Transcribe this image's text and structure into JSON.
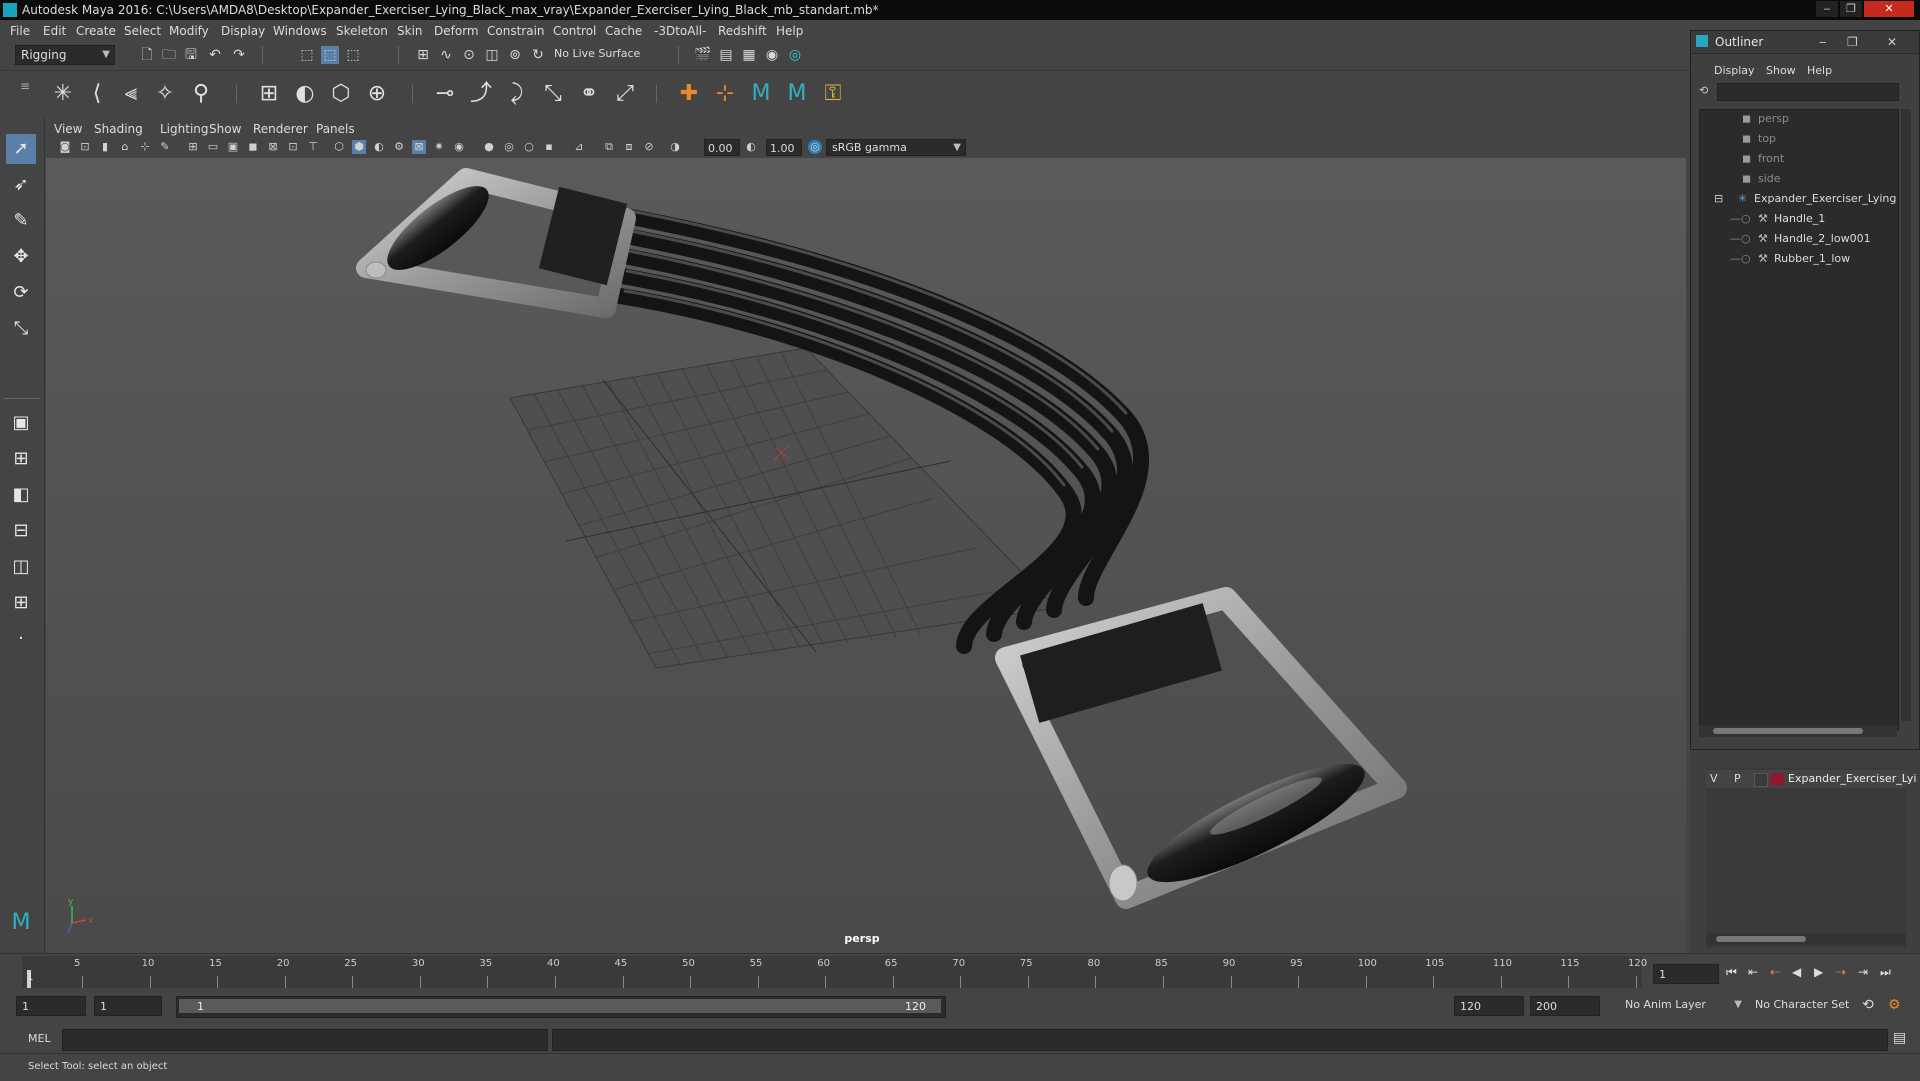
{
  "window": {
    "title": "Autodesk Maya 2016: C:\\Users\\AMDA8\\Desktop\\Expander_Exerciser_Lying_Black_max_vray\\Expander_Exerciser_Lying_Black_mb_standart.mb*",
    "controls": [
      "‒",
      "❐",
      "✕"
    ]
  },
  "menubar": [
    "File",
    "Edit",
    "Create",
    "Select",
    "Modify",
    "Display",
    "Windows",
    "Skeleton",
    "Skin",
    "Deform",
    "Constrain",
    "Control",
    "Cache",
    "-3DtoAll-",
    "Redshift",
    "Help"
  ],
  "shelf": {
    "menu_set": "Rigging",
    "live_surface": "No Live Surface"
  },
  "panel_menu": [
    "View",
    "Shading",
    "Lighting",
    "Show",
    "Renderer",
    "Panels"
  ],
  "viewport_toolbar": {
    "exposure": "0.00",
    "gamma": "1.00",
    "color_space": "sRGB gamma"
  },
  "viewport": {
    "camera_label": "persp",
    "axis_x": "x",
    "axis_y": "y"
  },
  "outliner": {
    "title": "Outliner",
    "menu": [
      "Display",
      "Show",
      "Help"
    ],
    "items": [
      {
        "label": "persp",
        "kind": "camera"
      },
      {
        "label": "top",
        "kind": "camera"
      },
      {
        "label": "front",
        "kind": "camera"
      },
      {
        "label": "side",
        "kind": "camera"
      },
      {
        "label": "Expander_Exerciser_Lying",
        "kind": "group"
      },
      {
        "label": "Handle_1",
        "kind": "mesh"
      },
      {
        "label": "Handle_2_low001",
        "kind": "mesh"
      },
      {
        "label": "Rubber_1_low",
        "kind": "mesh"
      }
    ]
  },
  "layer_editor": {
    "visible": "V",
    "playback": "P",
    "layer_name": "Expander_Exerciser_Lyi",
    "layer_color": "#8b1a2c"
  },
  "timeline": {
    "ticks": [
      "5",
      "10",
      "15",
      "20",
      "25",
      "30",
      "35",
      "40",
      "45",
      "50",
      "55",
      "60",
      "65",
      "70",
      "75",
      "80",
      "85",
      "90",
      "95",
      "100",
      "105",
      "110",
      "115",
      "120"
    ],
    "current_frame_marker": "1",
    "current_frame": "1"
  },
  "range": {
    "start": "1",
    "playback_start": "1",
    "slider_start": "1",
    "slider_end": "120",
    "playback_end": "120",
    "end": "200",
    "anim_layer": "No Anim Layer",
    "character_set": "No Character Set"
  },
  "command_line": {
    "label": "MEL"
  },
  "status": {
    "help_line": "Select Tool: select an object"
  }
}
